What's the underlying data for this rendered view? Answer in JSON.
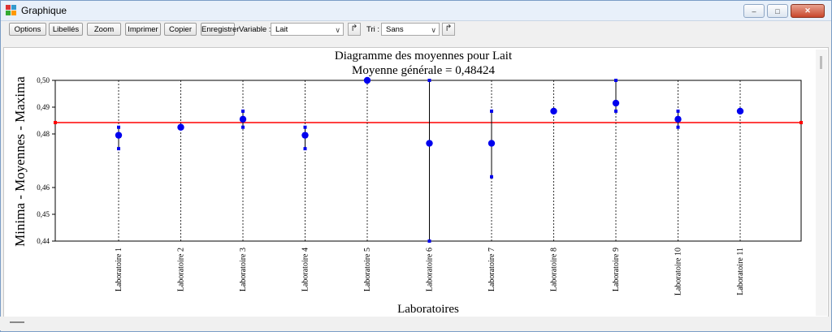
{
  "window": {
    "title": "Graphique"
  },
  "toolbar": {
    "options": "Options",
    "libelles": "Libellés",
    "zoom": "Zoom",
    "imprimer": "Imprimer",
    "copier": "Copier",
    "enregistrer": "Enregistrer",
    "variable_label": "Variable :",
    "variable_value": "Lait",
    "tri_label": "Tri :",
    "tri_value": "Sans"
  },
  "chart_data": {
    "type": "scatter",
    "title": "Diagramme des moyennes pour Lait",
    "subtitle": "Moyenne générale = 0,48424",
    "xlabel": "Laboratoires",
    "ylabel": "Minima - Moyennes - Maxima",
    "ylim": [
      0.44,
      0.5
    ],
    "y_ticks": [
      "0,44",
      "0,45",
      "0,46",
      "0,48",
      "0,49",
      "0,50"
    ],
    "grand_mean": 0.48424,
    "grand_mean_color": "#ff0000",
    "point_color": "#0000ee",
    "categories": [
      "Laboratoire 1",
      "Laboratoire 2",
      "Laboratoire 3",
      "Laboratoire 4",
      "Laboratoire 5",
      "Laboratoire 6",
      "Laboratoire 7",
      "Laboratoire 8",
      "Laboratoire 9",
      "Laboratoire 10",
      "Laboratoire 11"
    ],
    "series": [
      {
        "name": "Moyennes",
        "values": [
          0.4795,
          0.4825,
          0.4855,
          0.4795,
          0.5,
          0.4765,
          0.4765,
          0.4885,
          0.4915,
          0.4855,
          0.4885
        ]
      },
      {
        "name": "Minima",
        "values": [
          0.4745,
          0.4825,
          0.4825,
          0.4745,
          0.5,
          0.44,
          0.464,
          0.4885,
          0.4885,
          0.4825,
          0.4885
        ]
      },
      {
        "name": "Maxima",
        "values": [
          0.4825,
          0.4825,
          0.4885,
          0.4825,
          0.5,
          0.5,
          0.4885,
          0.4885,
          0.5,
          0.4885,
          0.4885
        ]
      }
    ]
  }
}
